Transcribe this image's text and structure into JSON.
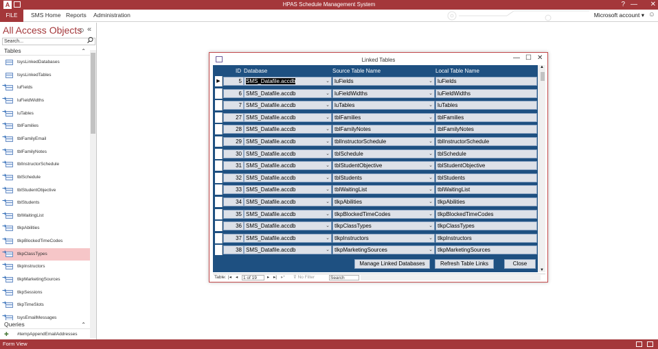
{
  "window": {
    "title": "HPAS Schedule Management System",
    "help": "?",
    "min": "—",
    "max": "☐",
    "close": "✕"
  },
  "ribbon": {
    "file": "FILE",
    "tabs": [
      "SMS Home",
      "Reports",
      "Administration"
    ],
    "account": "Microsoft account",
    "account_caret": "▾",
    "account_avatar": "☺"
  },
  "nav": {
    "header": "All Access Objects",
    "header_dropdown": "⊙",
    "header_collapse": "«",
    "search_placeholder": "Search...",
    "groups": {
      "tables": "Tables",
      "queries": "Queries"
    },
    "collapse_glyph": "⌃",
    "tables": [
      {
        "label": "tsysLinkedDatabases",
        "linked": false
      },
      {
        "label": "tsysLinkedTables",
        "linked": false
      },
      {
        "label": "luFields",
        "linked": true
      },
      {
        "label": "luFieldWidths",
        "linked": true
      },
      {
        "label": "luTables",
        "linked": true
      },
      {
        "label": "tblFamilies",
        "linked": true
      },
      {
        "label": "tblFamilyEmail",
        "linked": true
      },
      {
        "label": "tblFamilyNotes",
        "linked": true
      },
      {
        "label": "tblInstructorSchedule",
        "linked": true
      },
      {
        "label": "tblSchedule",
        "linked": true
      },
      {
        "label": "tblStudentObjective",
        "linked": true
      },
      {
        "label": "tblStudents",
        "linked": true
      },
      {
        "label": "tblWaitingList",
        "linked": true
      },
      {
        "label": "tlkpAbilities",
        "linked": true
      },
      {
        "label": "tlkpBlockedTimeCodes",
        "linked": true
      },
      {
        "label": "tlkpClassTypes",
        "linked": true,
        "selected": true
      },
      {
        "label": "tlkpInstructors",
        "linked": true
      },
      {
        "label": "tlkpMarketingSources",
        "linked": true
      },
      {
        "label": "tlkpSessions",
        "linked": true
      },
      {
        "label": "tlkpTimeSlots",
        "linked": true
      },
      {
        "label": "tsysEmailMessages",
        "linked": true
      }
    ],
    "queries": [
      {
        "label": "#tempAppendEmailAddresses"
      }
    ]
  },
  "dialog": {
    "title": "Linked Tables",
    "min": "—",
    "max": "☐",
    "close": "✕",
    "headers": {
      "id": "ID",
      "database": "Database",
      "source": "Source Table Name",
      "local": "Local Table Name"
    },
    "current_record_marker": "▶",
    "dropdown_glyph": "⌄",
    "rows": [
      {
        "id": "5",
        "database": "SMS_Datafile.accdb",
        "source": "luFields",
        "local": "luFields"
      },
      {
        "id": "6",
        "database": "SMS_Datafile.accdb",
        "source": "luFieldWidths",
        "local": "luFieldWidths"
      },
      {
        "id": "7",
        "database": "SMS_Datafile.accdb",
        "source": "luTables",
        "local": "luTables"
      },
      {
        "id": "27",
        "database": "SMS_Datafile.accdb",
        "source": "tblFamilies",
        "local": "tblFamilies"
      },
      {
        "id": "28",
        "database": "SMS_Datafile.accdb",
        "source": "tblFamilyNotes",
        "local": "tblFamilyNotes"
      },
      {
        "id": "29",
        "database": "SMS_Datafile.accdb",
        "source": "tblInstructorSchedule",
        "local": "tblInstructorSchedule"
      },
      {
        "id": "30",
        "database": "SMS_Datafile.accdb",
        "source": "tblSchedule",
        "local": "tblSchedule"
      },
      {
        "id": "31",
        "database": "SMS_Datafile.accdb",
        "source": "tblStudentObjective",
        "local": "tblStudentObjective"
      },
      {
        "id": "32",
        "database": "SMS_Datafile.accdb",
        "source": "tblStudents",
        "local": "tblStudents"
      },
      {
        "id": "33",
        "database": "SMS_Datafile.accdb",
        "source": "tblWaitingList",
        "local": "tblWaitingList"
      },
      {
        "id": "34",
        "database": "SMS_Datafile.accdb",
        "source": "tlkpAbilities",
        "local": "tlkpAbilities"
      },
      {
        "id": "35",
        "database": "SMS_Datafile.accdb",
        "source": "tlkpBlockedTimeCodes",
        "local": "tlkpBlockedTimeCodes"
      },
      {
        "id": "36",
        "database": "SMS_Datafile.accdb",
        "source": "tlkpClassTypes",
        "local": "tlkpClassTypes"
      },
      {
        "id": "37",
        "database": "SMS_Datafile.accdb",
        "source": "tlkpInstructors",
        "local": "tlkpInstructors"
      },
      {
        "id": "38",
        "database": "SMS_Datafile.accdb",
        "source": "tlkpMarketingSources",
        "local": "tlkpMarketingSources"
      }
    ],
    "buttons": {
      "manage": "Manage Linked Databases",
      "refresh": "Refresh Table Links",
      "close": "Close"
    },
    "record_nav": {
      "label": "Table:",
      "first": "|◂",
      "prev": "◂",
      "position": "1 of 19",
      "next": "▸",
      "last": "▸|",
      "new": "▸*",
      "filter": "No Filter",
      "search": "Search"
    }
  },
  "statusbar": {
    "text": "Form View"
  },
  "colors": {
    "access_red": "#a4373a",
    "form_blue": "#1e5081",
    "field_bg": "#dde1e8",
    "selected_nav": "#f6c6c8"
  }
}
